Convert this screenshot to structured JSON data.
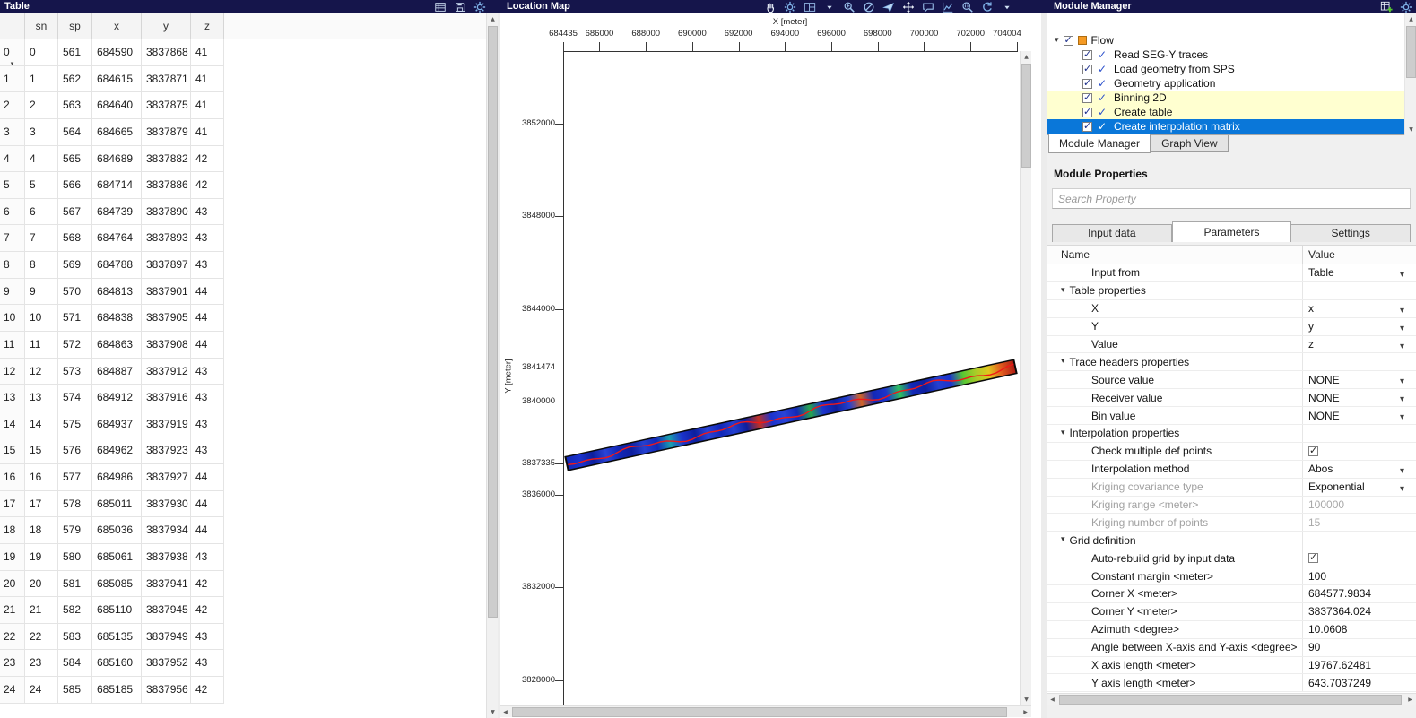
{
  "top_bar": {
    "table_title": "Table",
    "map_title": "Location Map",
    "module_title": "Module Manager",
    "table_toolbar_icons": [
      "table-list-icon",
      "save-icon",
      "gear-icon"
    ],
    "map_toolbar_icons": [
      "pan-hand-icon",
      "gear-icon",
      "layout-panels-icon",
      "dropdown-arrow-icon",
      "zoom-in-icon",
      "zoom-off-icon",
      "send-icon",
      "move-crosshair-icon",
      "comment-icon",
      "chart-icon",
      "zoom-actual-icon",
      "refresh-icon",
      "dropdown-arrow-icon"
    ],
    "window_icons": [
      "add-grid-icon",
      "gear-icon"
    ]
  },
  "table": {
    "columns": [
      "",
      "sn",
      "sp",
      "x",
      "y",
      "z"
    ],
    "rows": [
      [
        "0",
        "0",
        "561",
        "684590",
        "3837868",
        "41"
      ],
      [
        "1",
        "1",
        "562",
        "684615",
        "3837871",
        "41"
      ],
      [
        "2",
        "2",
        "563",
        "684640",
        "3837875",
        "41"
      ],
      [
        "3",
        "3",
        "564",
        "684665",
        "3837879",
        "41"
      ],
      [
        "4",
        "4",
        "565",
        "684689",
        "3837882",
        "42"
      ],
      [
        "5",
        "5",
        "566",
        "684714",
        "3837886",
        "42"
      ],
      [
        "6",
        "6",
        "567",
        "684739",
        "3837890",
        "43"
      ],
      [
        "7",
        "7",
        "568",
        "684764",
        "3837893",
        "43"
      ],
      [
        "8",
        "8",
        "569",
        "684788",
        "3837897",
        "43"
      ],
      [
        "9",
        "9",
        "570",
        "684813",
        "3837901",
        "44"
      ],
      [
        "10",
        "10",
        "571",
        "684838",
        "3837905",
        "44"
      ],
      [
        "11",
        "11",
        "572",
        "684863",
        "3837908",
        "44"
      ],
      [
        "12",
        "12",
        "573",
        "684887",
        "3837912",
        "43"
      ],
      [
        "13",
        "13",
        "574",
        "684912",
        "3837916",
        "43"
      ],
      [
        "14",
        "14",
        "575",
        "684937",
        "3837919",
        "43"
      ],
      [
        "15",
        "15",
        "576",
        "684962",
        "3837923",
        "43"
      ],
      [
        "16",
        "16",
        "577",
        "684986",
        "3837927",
        "44"
      ],
      [
        "17",
        "17",
        "578",
        "685011",
        "3837930",
        "44"
      ],
      [
        "18",
        "18",
        "579",
        "685036",
        "3837934",
        "44"
      ],
      [
        "19",
        "19",
        "580",
        "685061",
        "3837938",
        "43"
      ],
      [
        "20",
        "20",
        "581",
        "685085",
        "3837941",
        "42"
      ],
      [
        "21",
        "21",
        "582",
        "685110",
        "3837945",
        "42"
      ],
      [
        "22",
        "22",
        "583",
        "685135",
        "3837949",
        "43"
      ],
      [
        "23",
        "23",
        "584",
        "685160",
        "3837952",
        "43"
      ],
      [
        "24",
        "24",
        "585",
        "685185",
        "3837956",
        "42"
      ]
    ]
  },
  "chart_data": {
    "type": "scatter",
    "title": "Location Map",
    "xlabel": "X [meter]",
    "ylabel": "Y [meter]",
    "xlim": [
      684435,
      704004
    ],
    "ylim": [
      3826990,
      3855130
    ],
    "x_ticks": [
      684435,
      686000,
      688000,
      690000,
      692000,
      694000,
      696000,
      698000,
      700000,
      702000,
      704004
    ],
    "y_ticks": [
      3852000,
      3848000,
      3844000,
      3841474,
      3840000,
      3837335,
      3836000,
      3832000,
      3828000
    ],
    "grid": false,
    "profile": {
      "start_xy": [
        684590,
        3837390
      ],
      "end_xy": [
        703850,
        3841560
      ],
      "width_meters": 643.7,
      "outline_color": "#0a0a0a",
      "center_line_color": "#f01818",
      "segment_colors": [
        "#1228b8",
        "#1c33cc",
        "#0d1f9e",
        "#2a44d8",
        "#1228b8",
        "#0d1f9e",
        "#2440d0",
        "#1228b8",
        "#1a9fae",
        "#1c33cc",
        "#0d1f9e",
        "#2a44d8",
        "#1228b8",
        "#2440d0",
        "#0d1f9e",
        "#c03224",
        "#1c33cc",
        "#2a44d8",
        "#1228b8",
        "#27a54e",
        "#1c33cc",
        "#0d1f9e",
        "#2440d0",
        "#d06428",
        "#1228b8",
        "#1c33cc",
        "#2ec25e",
        "#1228b8",
        "#0d1f9e",
        "#2440d0",
        "#1c33cc",
        "#57c832",
        "#a8cc28",
        "#e0c81e",
        "#e05a1e",
        "#b01e14"
      ]
    }
  },
  "module_manager": {
    "flow_label": "Flow",
    "flow_items": [
      {
        "label": "Read SEG-Y traces",
        "checked": true,
        "highlight": "none"
      },
      {
        "label": "Load geometry from SPS",
        "checked": true,
        "highlight": "none"
      },
      {
        "label": "Geometry application",
        "checked": true,
        "highlight": "none"
      },
      {
        "label": "Binning 2D",
        "checked": true,
        "highlight": "yellow"
      },
      {
        "label": "Create table",
        "checked": true,
        "highlight": "yellow"
      },
      {
        "label": "Create interpolation matrix",
        "checked": true,
        "highlight": "selected"
      }
    ],
    "view_tabs": [
      {
        "label": "Module Manager",
        "active": true
      },
      {
        "label": "Graph View",
        "active": false
      }
    ],
    "properties_title": "Module Properties",
    "search_placeholder": "Search Property",
    "prop_tabs": [
      {
        "label": "Input data",
        "active": false
      },
      {
        "label": "Parameters",
        "active": true
      },
      {
        "label": "Settings",
        "active": false
      }
    ],
    "grid_headers": [
      "Name",
      "Value"
    ],
    "properties": [
      {
        "kind": "item",
        "name": "Input from",
        "value": "Table",
        "control": "dropdown"
      },
      {
        "kind": "group",
        "name": "Table properties"
      },
      {
        "kind": "item",
        "name": "X",
        "value": "x",
        "control": "dropdown"
      },
      {
        "kind": "item",
        "name": "Y",
        "value": "y",
        "control": "dropdown"
      },
      {
        "kind": "item",
        "name": "Value",
        "value": "z",
        "control": "dropdown"
      },
      {
        "kind": "group",
        "name": "Trace headers properties"
      },
      {
        "kind": "item",
        "name": "Source value",
        "value": "NONE",
        "control": "dropdown"
      },
      {
        "kind": "item",
        "name": "Receiver value",
        "value": "NONE",
        "control": "dropdown"
      },
      {
        "kind": "item",
        "name": "Bin value",
        "value": "NONE",
        "control": "dropdown"
      },
      {
        "kind": "group",
        "name": "Interpolation properties"
      },
      {
        "kind": "item",
        "name": "Check multiple def points",
        "control": "checkbox",
        "checked": true
      },
      {
        "kind": "item",
        "name": "Interpolation method",
        "value": "Abos",
        "control": "dropdown"
      },
      {
        "kind": "item",
        "name": "Kriging covariance type",
        "value": "Exponential",
        "control": "dropdown",
        "disabled": true
      },
      {
        "kind": "item",
        "name": "Kriging range <meter>",
        "value": "100000",
        "control": "text",
        "disabled": true,
        "value_disabled": true
      },
      {
        "kind": "item",
        "name": "Kriging number of points",
        "value": "15",
        "control": "text",
        "disabled": true,
        "value_disabled": true
      },
      {
        "kind": "group",
        "name": "Grid definition"
      },
      {
        "kind": "item",
        "name": "Auto-rebuild grid by input data",
        "control": "checkbox",
        "checked": true
      },
      {
        "kind": "item",
        "name": "Constant margin <meter>",
        "value": "100",
        "control": "text"
      },
      {
        "kind": "item",
        "name": "Corner X <meter>",
        "value": "684577.9834",
        "control": "text"
      },
      {
        "kind": "item",
        "name": "Corner Y <meter>",
        "value": "3837364.024",
        "control": "text"
      },
      {
        "kind": "item",
        "name": "Azimuth <degree>",
        "value": "10.0608",
        "control": "text"
      },
      {
        "kind": "item",
        "name": "Angle between X-axis and Y-axis <degree>",
        "value": "90",
        "control": "text"
      },
      {
        "kind": "item",
        "name": "X axis length <meter>",
        "value": "19767.62481",
        "control": "text"
      },
      {
        "kind": "item",
        "name": "Y axis length <meter>",
        "value": "643.7037249",
        "control": "text"
      }
    ]
  }
}
